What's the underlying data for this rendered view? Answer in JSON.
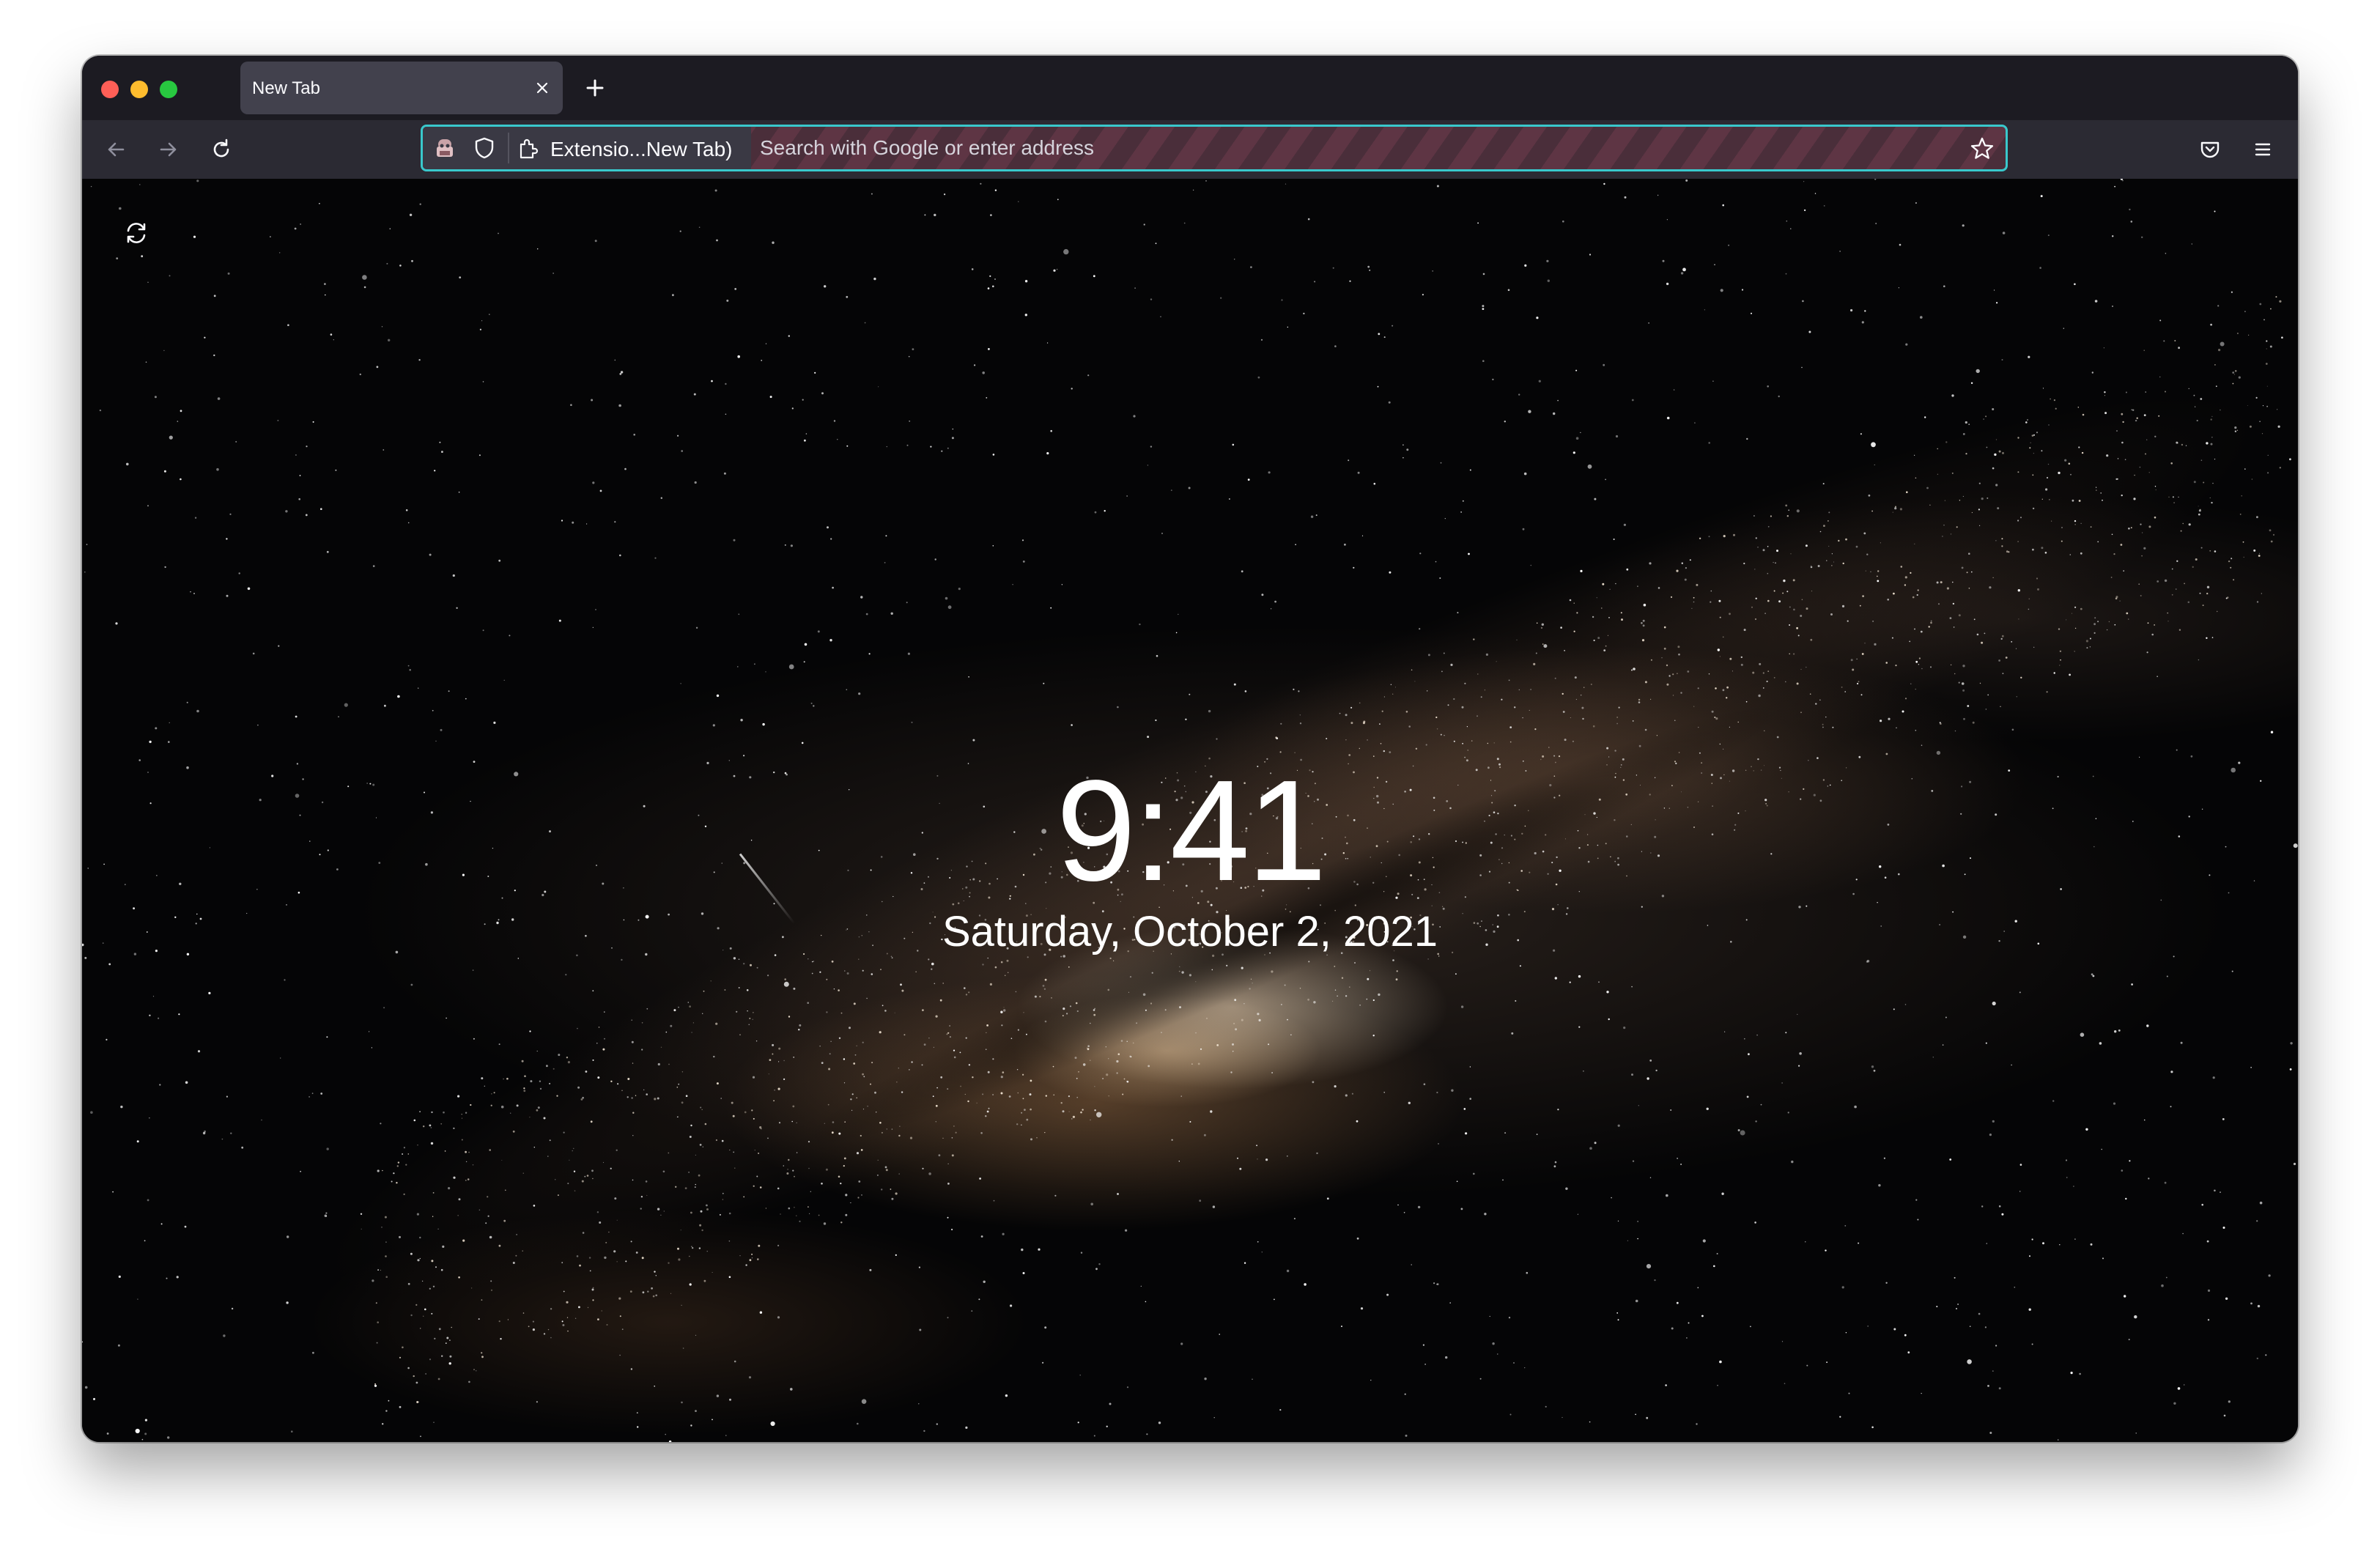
{
  "window": {
    "controls": [
      "close",
      "minimize",
      "maximize"
    ]
  },
  "tabs": [
    {
      "title": "New Tab",
      "active": true
    }
  ],
  "toolbar": {
    "back_icon": "arrow-left-icon",
    "forward_icon": "arrow-right-icon",
    "reload_icon": "reload-icon",
    "pocket_icon": "pocket-icon",
    "menu_icon": "hamburger-menu-icon"
  },
  "urlbar": {
    "identity_label": "Extensio...New Tab)",
    "placeholder": "Search with Google or enter address",
    "value": "",
    "focus_color": "#39c8cc",
    "stripe_colors": [
      "#4a2e3a",
      "#5e3544"
    ]
  },
  "page": {
    "time": "9:41",
    "date": "Saturday, October 2, 2021",
    "refresh_icon": "refresh-background-icon",
    "background": "milky-way-night-sky"
  },
  "colors": {
    "tabbar": "#1c1b22",
    "toolbar": "#2b2a33",
    "active_tab": "#42414d",
    "text": "#fbfbfe"
  }
}
